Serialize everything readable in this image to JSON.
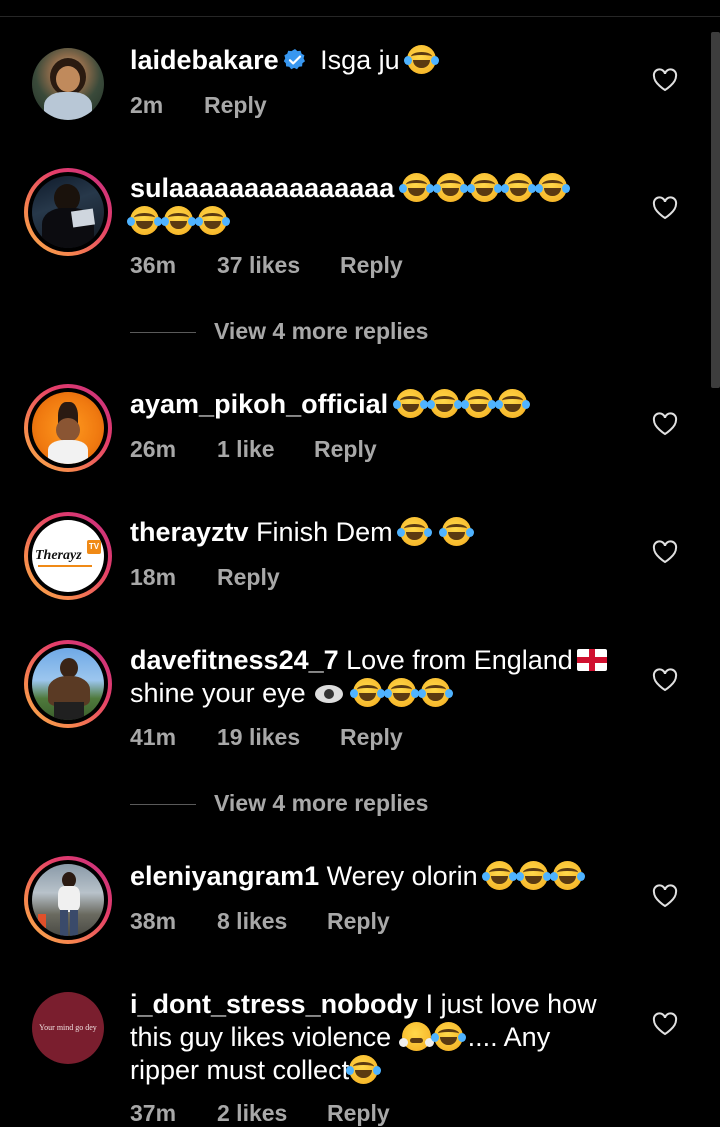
{
  "colors": {
    "background": "#000000",
    "secondary_text": "#a8a8a8",
    "story_ring": [
      "#f9b44a",
      "#e43d6a",
      "#c22e84"
    ],
    "verified": "#3897f0"
  },
  "comments": [
    {
      "username": "laidebakare",
      "verified": true,
      "text": "Isga ju",
      "emoji": "😂",
      "time": "2m",
      "likes": "",
      "reply": "Reply",
      "avatar": "profile-photo"
    },
    {
      "username": "sulaaaaaaaaaaaaaaa",
      "verified": false,
      "text": "",
      "emoji": "😂😂😂😂😂😂😂😂",
      "time": "36m",
      "likes": "37 likes",
      "reply": "Reply",
      "avatar": "profile-photo"
    },
    {
      "username": "ayam_pikoh_official",
      "verified": false,
      "text": "",
      "emoji": "😂😂😂😂",
      "time": "26m",
      "likes": "1 like",
      "reply": "Reply",
      "avatar": "profile-photo"
    },
    {
      "username": "therayztv",
      "verified": false,
      "text": "Finish Dem",
      "emoji": "😂 😂",
      "time": "18m",
      "likes": "",
      "reply": "Reply",
      "avatar": "Therayz logo"
    },
    {
      "username": "davefitness24_7",
      "verified": false,
      "text": "Love from England",
      "text2": "shine your eye",
      "emoji": "🏴 👁 😂😂😂",
      "time": "41m",
      "likes": "19 likes",
      "reply": "Reply",
      "avatar": "profile-photo"
    },
    {
      "username": "eleniyangram1",
      "verified": false,
      "text": "Werey olorin",
      "emoji": "😂😂😂",
      "time": "38m",
      "likes": "8 likes",
      "reply": "Reply",
      "avatar": "profile-photo"
    },
    {
      "username": "i_dont_stress_nobody",
      "verified": false,
      "text": "I just love how",
      "text2": "this guy likes violence",
      "text3": ".... Any",
      "text4": "ripper must collect",
      "emoji": "😤😂 😂",
      "time": "37m",
      "likes": "2 likes",
      "reply": "Reply",
      "avatar": "Your mind go dey"
    }
  ],
  "view_more": [
    "View 4 more replies",
    "View 4 more replies"
  ],
  "avatar_text": {
    "therayz": "Therayz",
    "therayz_tv": "TV",
    "mind": "Your mind go dey"
  }
}
